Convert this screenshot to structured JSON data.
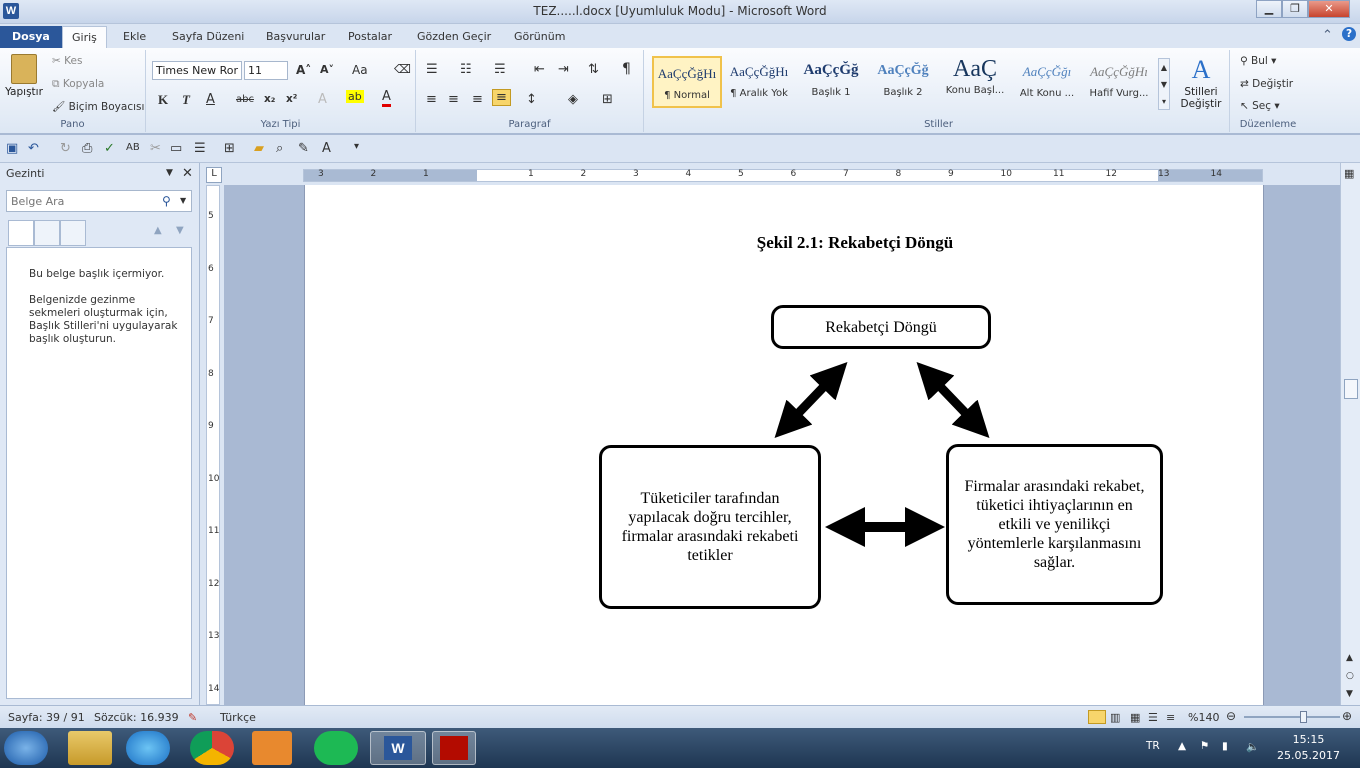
{
  "window": {
    "title": "TEZ.....l.docx [Uyumluluk Modu]  -  Microsoft Word",
    "minimize_icon": "minimize-icon",
    "maximize_icon": "restore-icon",
    "close_icon": "close-icon"
  },
  "tabs": [
    {
      "label": "Dosya"
    },
    {
      "label": "Giriş"
    },
    {
      "label": "Ekle"
    },
    {
      "label": "Sayfa Düzeni"
    },
    {
      "label": "Başvurular"
    },
    {
      "label": "Postalar"
    },
    {
      "label": "Gözden Geçir"
    },
    {
      "label": "Görünüm"
    }
  ],
  "ribbon": {
    "clipboard": {
      "label": "Pano",
      "paste": "Yapıştır",
      "cut": "Kes",
      "copy": "Kopyala",
      "format_painter": "Biçim Boyacısı"
    },
    "font": {
      "label": "Yazı Tipi",
      "font_name": "Times New Ror",
      "font_size": "11",
      "bold": "K",
      "italic": "T",
      "underline": "A",
      "strikethrough": "abc",
      "subscript": "x₂",
      "superscript": "x²",
      "grow": "A˄",
      "shrink": "A˅",
      "change_case": "Aa"
    },
    "paragraph": {
      "label": "Paragraf",
      "pilcrow": "¶"
    },
    "styles": {
      "label": "Stiller",
      "items": [
        {
          "preview": "AaÇçĞğHı",
          "name": "¶ Normal"
        },
        {
          "preview": "AaÇçĞğHı",
          "name": "¶ Aralık Yok"
        },
        {
          "preview": "AaÇçĞğ",
          "name": "Başlık 1"
        },
        {
          "preview": "AaÇçĞğ",
          "name": "Başlık 2"
        },
        {
          "preview": "AaÇ",
          "name": "Konu Başl..."
        },
        {
          "preview": "AaÇçĞğı",
          "name": "Alt Konu ..."
        },
        {
          "preview": "AaÇçĞğHı",
          "name": "Hafif Vurg..."
        }
      ],
      "change_styles_line1": "Stilleri",
      "change_styles_line2": "Değiştir"
    },
    "editing": {
      "label": "Düzenleme",
      "find": "Bul",
      "replace": "Değiştir",
      "select": "Seç"
    }
  },
  "nav": {
    "title": "Gezinti",
    "search_placeholder": "Belge Ara",
    "msg1": "Bu belge başlık içermiyor.",
    "msg2": "Belgenizde gezinme sekmeleri oluşturmak için, Başlık Stilleri'ni uygulayarak başlık oluşturun."
  },
  "ruler": {
    "h_numbers": [
      "3",
      "2",
      "1",
      "1",
      "2",
      "3",
      "4",
      "5",
      "6",
      "7",
      "8",
      "9",
      "10",
      "11",
      "12",
      "13",
      "14"
    ],
    "v_numbers": [
      "5",
      "6",
      "7",
      "8",
      "9",
      "10",
      "11",
      "12",
      "13",
      "14"
    ]
  },
  "document": {
    "caption": "Şekil 2.1:  Rekabetçi Döngü",
    "box_top": "Rekabetçi Döngü",
    "box_left": "Tüketiciler  tarafından yapılacak doğru tercihler, firmalar  arasındaki rekabeti  tetikler",
    "box_right": "Firmalar  arasındaki rekabet, tüketici ihtiyaçlarının  en etkili  ve yenilikçi  yöntemlerle karşılanmasını sağlar."
  },
  "status": {
    "page": "Sayfa: 39 / 91",
    "words": "Sözcük: 16.939",
    "language": "Türkçe",
    "zoom": "%140",
    "zoom_level_percent": 140
  },
  "taskbar": {
    "lang": "TR",
    "time": "15:15",
    "date": "25.05.2017"
  }
}
